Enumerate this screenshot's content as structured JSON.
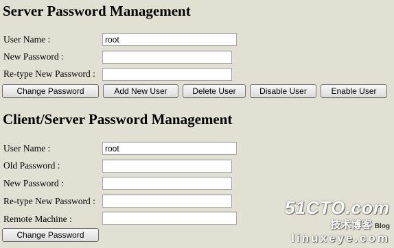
{
  "server_section": {
    "title": "Server Password Management",
    "labels": {
      "user_name": "User Name :",
      "new_password": "New Password :",
      "retype_new_password": "Re-type New Password :"
    },
    "values": {
      "user_name": "root",
      "new_password": "",
      "retype_new_password": ""
    },
    "buttons": {
      "change_password": "Change Password",
      "add_new_user": "Add New User",
      "delete_user": "Delete User",
      "disable_user": "Disable User",
      "enable_user": "Enable User"
    }
  },
  "client_section": {
    "title": "Client/Server Password Management",
    "labels": {
      "user_name": "User Name :",
      "old_password": "Old Password :",
      "new_password": "New Password :",
      "retype_new_password": "Re-type New Password :",
      "remote_machine": "Remote Machine :"
    },
    "values": {
      "user_name": "root",
      "old_password": "",
      "new_password": "",
      "retype_new_password": "",
      "remote_machine": ""
    },
    "buttons": {
      "change_password": "Change Password"
    }
  },
  "watermark": {
    "logo": "51CTO.com",
    "url": "linuxeye.com",
    "cn_text": "技术博客",
    "blog": "Blog"
  }
}
